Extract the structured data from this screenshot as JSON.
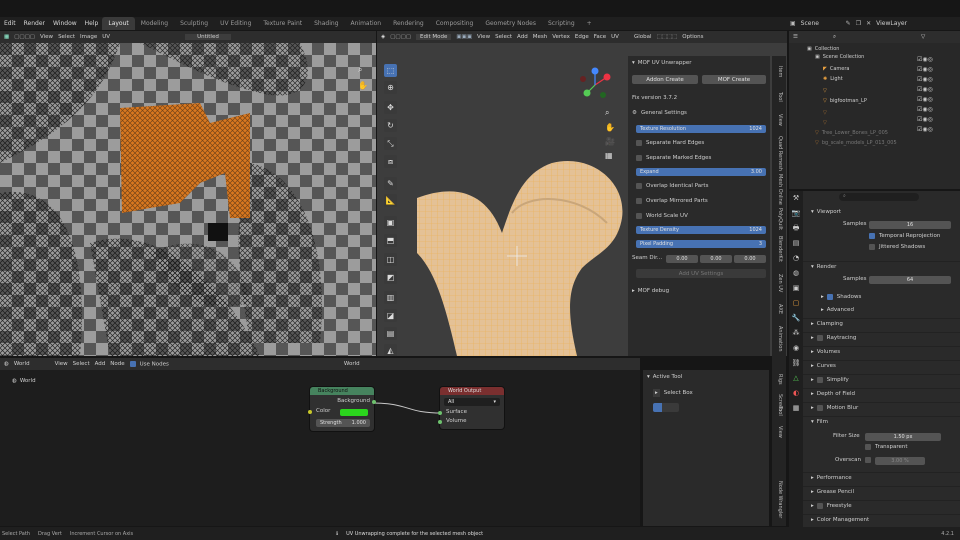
{
  "menus": [
    "Edit",
    "Render",
    "Window",
    "Help"
  ],
  "workspaces": [
    "Layout",
    "Modeling",
    "Sculpting",
    "UV Editing",
    "Texture Paint",
    "Shading",
    "Animation",
    "Rendering",
    "Compositing",
    "Geometry Nodes",
    "Scripting",
    "+"
  ],
  "scene_label": "Scene",
  "viewlayer_label": "ViewLayer",
  "uv_editor": {
    "menus": [
      "View",
      "Select",
      "Image",
      "UV"
    ],
    "image_name": "Untitled"
  },
  "viewport": {
    "mode": "Edit Mode",
    "menus": [
      "View",
      "Select",
      "Add",
      "Mesh",
      "Vertex",
      "Edge",
      "Face",
      "UV"
    ],
    "orientation": "Global",
    "options": "Options"
  },
  "mof": {
    "title": "MOF UV Unwrapper",
    "btn_addon": "Addon Create",
    "btn_mof": "MOF Create",
    "version": "Fix version 3.7.2",
    "general": "General Settings",
    "tex_res_label": "Texture Resolution",
    "tex_res_val": "1024",
    "separate_hard": "Separate Hard Edges",
    "separate_marked": "Separate Marked Edges",
    "expand_label": "Expand",
    "expand_val": "3.00",
    "overlap_identical": "Overlap Identical Parts",
    "overlap_mirrored": "Overlap Mirrored Parts",
    "world_scale": "World Scale UV",
    "tex_density_label": "Texture Density",
    "tex_density_val": "1024",
    "pixel_padding_label": "Pixel Padding",
    "pixel_padding_val": "3",
    "seam_label": "Seam Dir...",
    "seam_vals": [
      "0.00",
      "0.00",
      "0.00"
    ],
    "add_uv": "Add UV Settings",
    "debug": "MOF debug"
  },
  "vtabs": [
    "Item",
    "Tool",
    "View",
    "Quad Remesh",
    "Mesh Online",
    "PolyQuilt",
    "BlenderKit",
    "Zen UV",
    "AXE",
    "Animation",
    "Rigs",
    "Screen",
    "Tool",
    "View",
    "Node Wrangler"
  ],
  "outliner": {
    "title": "Scene Collection",
    "items": [
      "Collection",
      "Camera",
      "Light",
      "",
      "bigfootman_LP",
      "",
      "",
      "Tree_Lower_Bones_LP_005",
      "bg_scale_models_LP_013_005"
    ]
  },
  "properties": {
    "sections": [
      "Viewport",
      "Samples",
      "Temporal Reprojection",
      "Jittered Shadows",
      "Render",
      "Samples",
      "Shadows",
      "Advanced",
      "Clamping",
      "Raytracing",
      "Volumes",
      "Curves",
      "Simplify",
      "Depth of Field",
      "Motion Blur",
      "Film",
      "Filter Size",
      "Transparent",
      "Overscan",
      "Performance",
      "Grease Pencil",
      "Freestyle",
      "Color Management"
    ],
    "values": {
      "viewport_samples": "16",
      "render_samples": "64",
      "filter_size": "1.50 px",
      "overscan": "3.00 %"
    }
  },
  "node_editor": {
    "menus": [
      "World",
      "View",
      "Select",
      "Add",
      "Node"
    ],
    "use_nodes": "Use Nodes",
    "world_type": "World",
    "breadcrumb": "World",
    "bg_node": {
      "title": "Background",
      "out": "Background",
      "color": "Color",
      "strength": "Strength",
      "strength_val": "1.000"
    },
    "out_node": {
      "title": "World Output",
      "target": "All",
      "surface": "Surface",
      "volume": "Volume"
    }
  },
  "active_tool": {
    "title": "Active Tool",
    "name": "Select Box"
  },
  "status": {
    "left": "Select Path",
    "middle": "Drag Vert",
    "right": "Increment Cursor on Axis",
    "message": "UV Unwrapping complete for the selected mesh object",
    "version": "4.2.1"
  },
  "colors": {
    "accent": "#4772b3",
    "selection": "#ff8c00",
    "node_green": "#2bd51d",
    "wire": "#e8a94a"
  }
}
